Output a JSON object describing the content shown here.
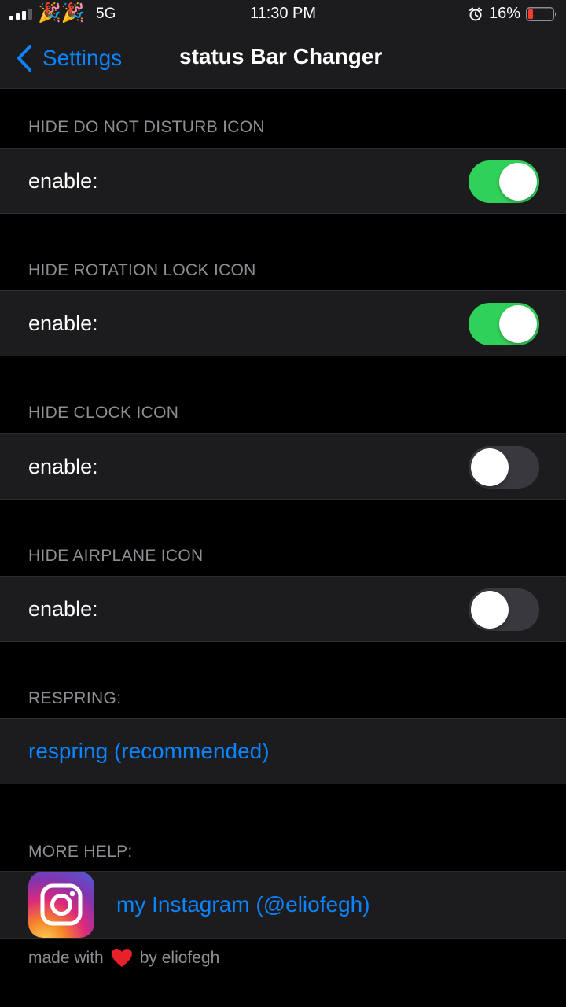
{
  "status_bar": {
    "emoji": "🎉🎉",
    "network": "5G",
    "time": "11:30 PM",
    "battery_percent": "16%"
  },
  "nav": {
    "back_label": "Settings",
    "title": "status Bar Changer"
  },
  "sections": [
    {
      "header": "HIDE DO NOT DISTURB ICON",
      "label": "enable:",
      "toggle_on": true
    },
    {
      "header": "HIDE ROTATION LOCK ICON",
      "label": "enable:",
      "toggle_on": true
    },
    {
      "header": "HIDE CLOCK ICON",
      "label": "enable:",
      "toggle_on": false
    },
    {
      "header": "HIDE AIRPLANE ICON",
      "label": "enable:",
      "toggle_on": false
    }
  ],
  "respring": {
    "header": "RESPRING:",
    "link": "respring (recommended)"
  },
  "help": {
    "header": "MORE HELP:",
    "instagram_label": "my Instagram (@eliofegh)",
    "icon": "instagram-icon"
  },
  "footer": {
    "prefix": "made with",
    "suffix": "by eliofegh"
  },
  "colors": {
    "accent": "#0a84ff",
    "toggle_on": "#30d158",
    "toggle_off": "#39393d",
    "cell_bg": "#1c1c1e",
    "background": "#000000"
  }
}
